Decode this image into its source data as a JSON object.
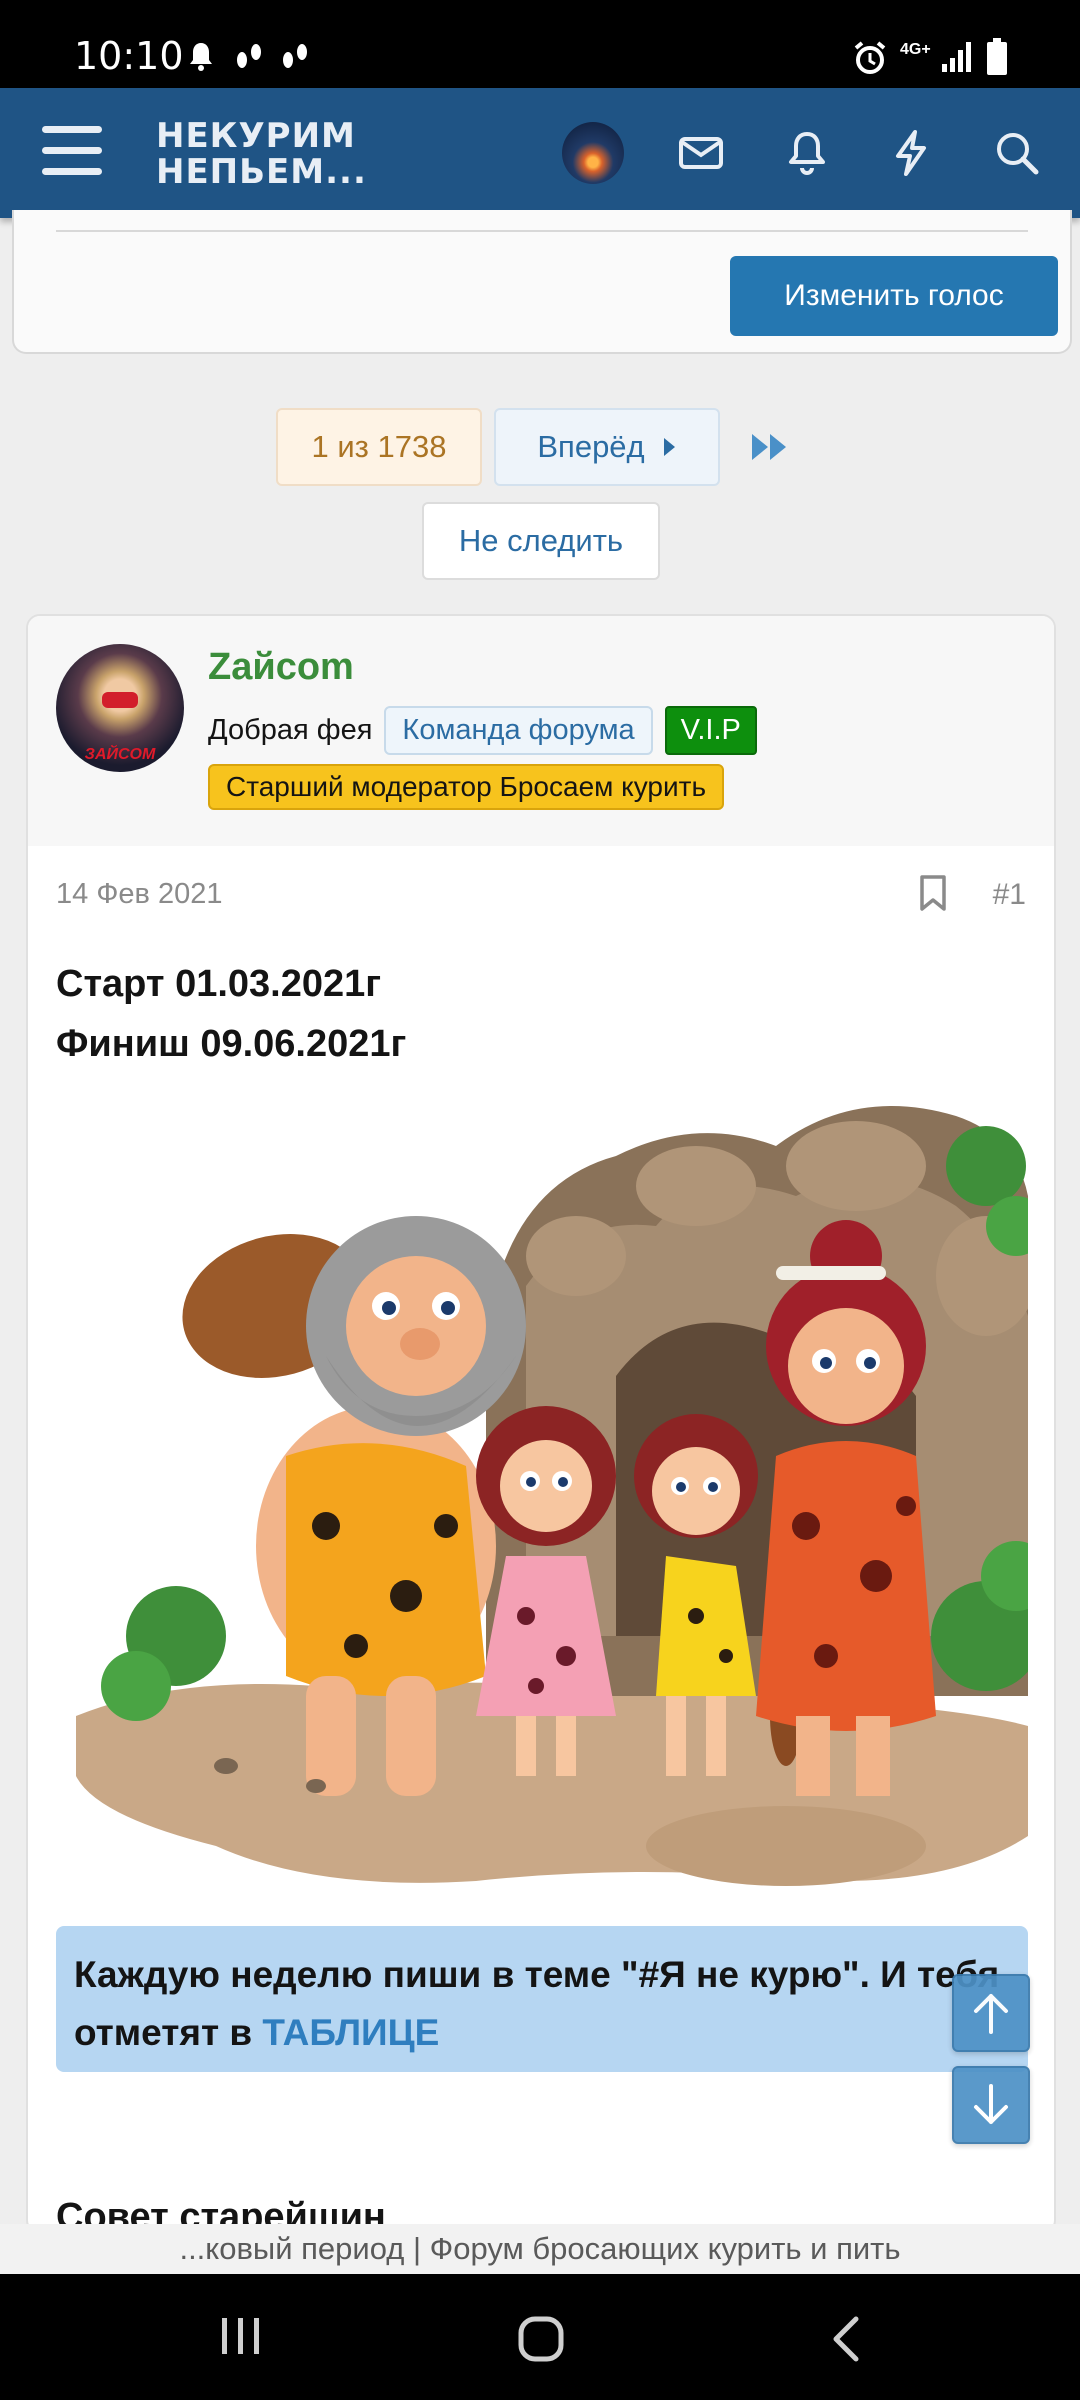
{
  "status_bar": {
    "time": "10:10",
    "network": "4G+"
  },
  "header": {
    "menu_icon": "hamburger-icon",
    "brand_line1": "НЕКУРИМ",
    "brand_line2": "НЕПЬЕМ...",
    "icons": [
      "avatar",
      "mail-icon",
      "bell-icon",
      "lightning-icon",
      "search-icon"
    ]
  },
  "poll": {
    "change_vote_label": "Изменить голос"
  },
  "pagination": {
    "current": "1 из 1738",
    "next_label": "Вперёд"
  },
  "watch": {
    "label": "Не следить"
  },
  "post": {
    "username": "Zайcom",
    "user_title": "Добрая фея",
    "badge_team": "Команда форума",
    "badge_vip": "V.I.P",
    "badge_moderator": "Старший модератор Бросаем курить",
    "avatar_text": "ЗАЙСОМ",
    "date": "14 Фев 2021",
    "number": "#1",
    "line1": "Старт 01.03.2021г",
    "line2": "Финиш 09.06.2021г",
    "quote_text": "Каждую неделю пиши в теме \"#Я не курю\". И тебя отметят в ",
    "quote_link": "ТАБЛИЦЕ",
    "next_heading": "Совет старейшин"
  },
  "page_title": "...ковый период | Форум бросающих курить и пить",
  "colors": {
    "header": "#1f5485",
    "primary_button": "#2577b1",
    "username": "#3b8d3b",
    "quote_bg": "#b6d6f2"
  }
}
